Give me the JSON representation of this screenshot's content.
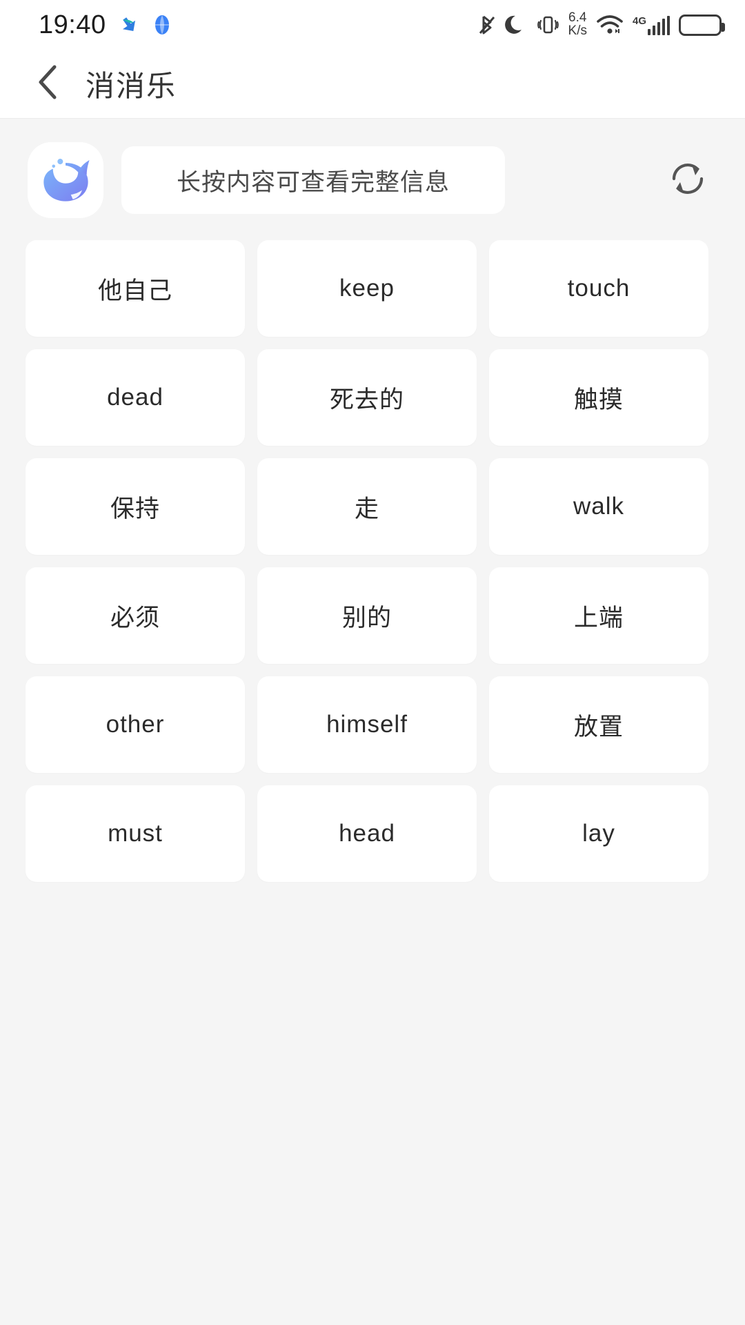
{
  "status_bar": {
    "time": "19:40",
    "net_speed_value": "6.4",
    "net_speed_unit": "K/s",
    "network_type": "4G",
    "left_icons": [
      "download-arrow-icon",
      "globe-icon"
    ],
    "right_icons": [
      "bluetooth-icon",
      "do-not-disturb-moon-icon",
      "vibrate-icon",
      "network-speed-indicator",
      "wifi-icon",
      "cellular-signal-4g-icon",
      "battery-icon"
    ]
  },
  "header": {
    "back_icon": "chevron-left-icon",
    "title": "消消乐"
  },
  "info_bar": {
    "avatar_icon": "whale-logo-icon",
    "hint_text": "长按内容可查看完整信息",
    "refresh_icon": "refresh-icon"
  },
  "grid": {
    "columns": 3,
    "cards": [
      {
        "label": "他自己"
      },
      {
        "label": "keep"
      },
      {
        "label": "touch"
      },
      {
        "label": "dead"
      },
      {
        "label": "死去的"
      },
      {
        "label": "触摸"
      },
      {
        "label": "保持"
      },
      {
        "label": "走"
      },
      {
        "label": "walk"
      },
      {
        "label": "必须"
      },
      {
        "label": "别的"
      },
      {
        "label": "上端"
      },
      {
        "label": "other"
      },
      {
        "label": "himself"
      },
      {
        "label": "放置"
      },
      {
        "label": "must"
      },
      {
        "label": "head"
      },
      {
        "label": "lay"
      }
    ]
  },
  "colors": {
    "page_background": "#f5f5f5",
    "card_background": "#ffffff",
    "header_background": "#ffffff",
    "text_primary": "#2b2b2b",
    "text_secondary": "#4a4a4a",
    "accent_blue": "#5b9bf5",
    "whale_gradient_start": "#7ab6fa",
    "whale_gradient_end": "#7d7df0"
  }
}
